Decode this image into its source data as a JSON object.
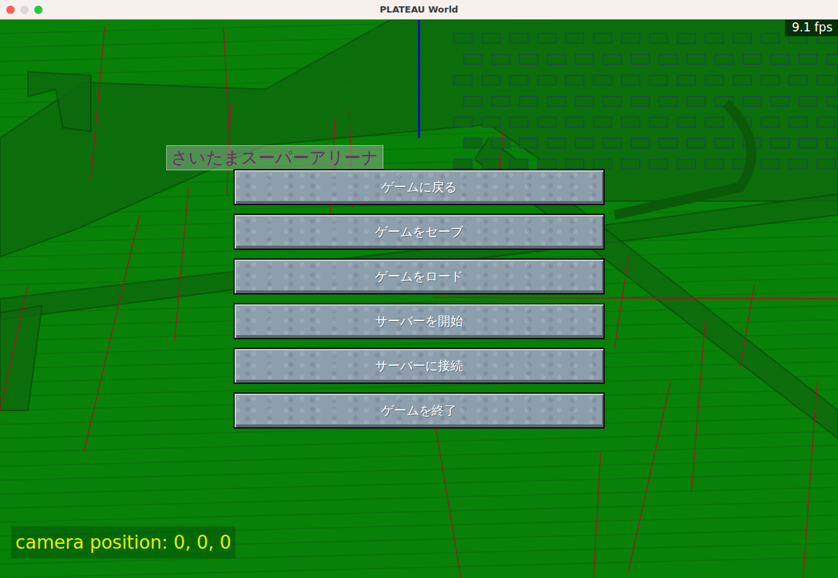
{
  "window": {
    "title": "PLATEAU World",
    "traffic_lights": [
      {
        "color": "#fe5f57"
      },
      {
        "color": "#d8d8d8"
      },
      {
        "color": "#28c840"
      }
    ]
  },
  "hud": {
    "fps": "9.1 fps",
    "camera": "camera position: 0, 0, 0"
  },
  "scene": {
    "labels": [
      "さいたまスーパーアリーナ"
    ]
  },
  "menu": {
    "buttons": [
      {
        "label": "ゲームに戻る"
      },
      {
        "label": "ゲームをセーブ"
      },
      {
        "label": "ゲームをロード"
      },
      {
        "label": "サーバーを開始"
      },
      {
        "label": "サーバーに接続"
      },
      {
        "label": "ゲームを終了"
      }
    ]
  }
}
